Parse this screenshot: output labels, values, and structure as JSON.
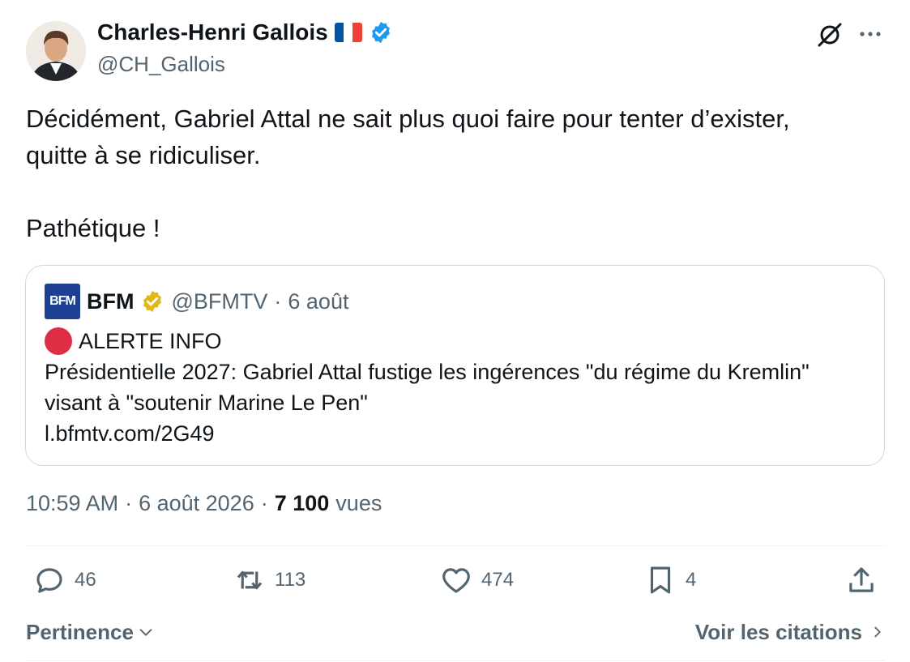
{
  "author": {
    "name": "Charles-Henri Gallois",
    "handle": "@CH_Gallois",
    "verified": true
  },
  "tweet": {
    "line1": "Décidément, Gabriel Attal ne sait plus quoi faire pour tenter d’exister,",
    "line2": "quitte à se ridiculiser.",
    "line3": "Pathétique !"
  },
  "quote": {
    "name": "BFM",
    "handle": "@BFMTV",
    "separator": "·",
    "date": "6 août",
    "logo_text": "BFM",
    "alert": "ALERTE INFO",
    "line1": "Présidentielle 2027: Gabriel Attal fustige les ingérences \"du régime du Kremlin\"",
    "line2": "visant à \"soutenir Marine Le Pen\"",
    "link": "l.bfmtv.com/2G49"
  },
  "meta": {
    "time": "10:59 AM",
    "sep1": "·",
    "date": "6 août 2026",
    "sep2": "·",
    "views_count": "7 100",
    "views_label": "vues"
  },
  "actions": {
    "replies": "46",
    "reposts": "113",
    "likes": "474",
    "bookmarks": "4"
  },
  "footer": {
    "sort_label": "Pertinence",
    "quotes_label": "Voir les citations"
  },
  "colors": {
    "text": "#0f1419",
    "secondary": "#536471",
    "verified_blue": "#1d9bf0",
    "verified_gold": "#e2b719",
    "alert_red": "#dd2e44",
    "bfm_blue": "#1d3f94"
  },
  "icons": [
    "flag-fr-icon",
    "verified-badge-icon",
    "grok-icon",
    "more-icon",
    "gold-badge-icon",
    "red-circle-icon",
    "reply-icon",
    "repost-icon",
    "like-icon",
    "bookmark-icon",
    "share-icon",
    "chevron-down-icon",
    "chevron-right-icon"
  ]
}
